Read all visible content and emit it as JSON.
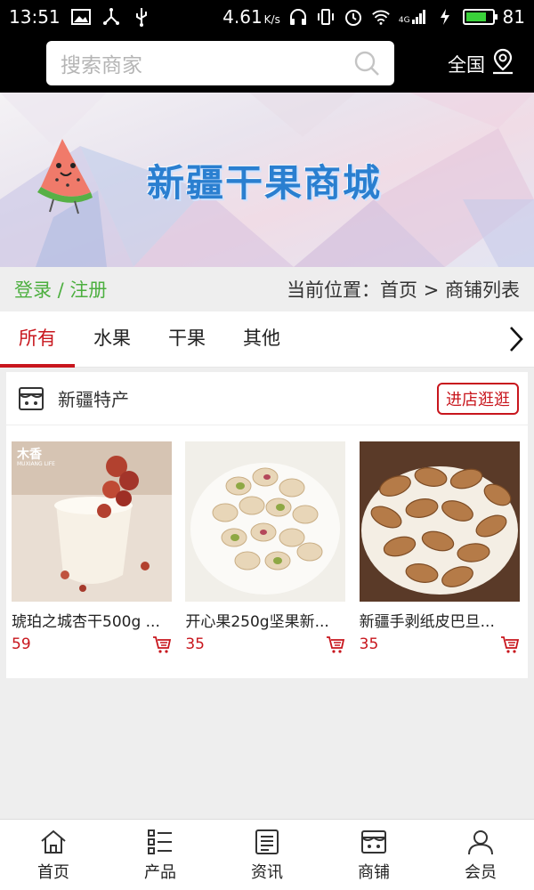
{
  "status_bar": {
    "time": "13:51",
    "speed": "4.61",
    "speed_unit": "K/s",
    "network": "4G",
    "battery": "81"
  },
  "header": {
    "search_placeholder": "搜索商家",
    "region": "全国"
  },
  "banner": {
    "title": "新疆干果商城"
  },
  "breadcrumb": {
    "login_register": "登录 / 注册",
    "location": "当前位置：首页 > 商铺列表"
  },
  "tabs": [
    {
      "label": "所有",
      "active": true
    },
    {
      "label": "水果",
      "active": false
    },
    {
      "label": "干果",
      "active": false
    },
    {
      "label": "其他",
      "active": false
    }
  ],
  "shop": {
    "name": "新疆特产",
    "visit_label": "进店逛逛",
    "products": [
      {
        "name": "琥珀之城杏干500g ...",
        "price": "59",
        "watermark": "木香",
        "watermark_sub": "MUXIANG LIFE"
      },
      {
        "name": "开心果250g坚果新...",
        "price": "35"
      },
      {
        "name": "新疆手剥纸皮巴旦...",
        "price": "35"
      }
    ]
  },
  "bottom_nav": [
    {
      "label": "首页",
      "icon": "home-icon"
    },
    {
      "label": "产品",
      "icon": "list-icon"
    },
    {
      "label": "资讯",
      "icon": "news-icon"
    },
    {
      "label": "商铺",
      "icon": "store-icon"
    },
    {
      "label": "会员",
      "icon": "user-icon"
    }
  ],
  "colors": {
    "accent": "#c8161d",
    "login_green": "#4caf3f",
    "banner_title": "#2a7fd0"
  }
}
